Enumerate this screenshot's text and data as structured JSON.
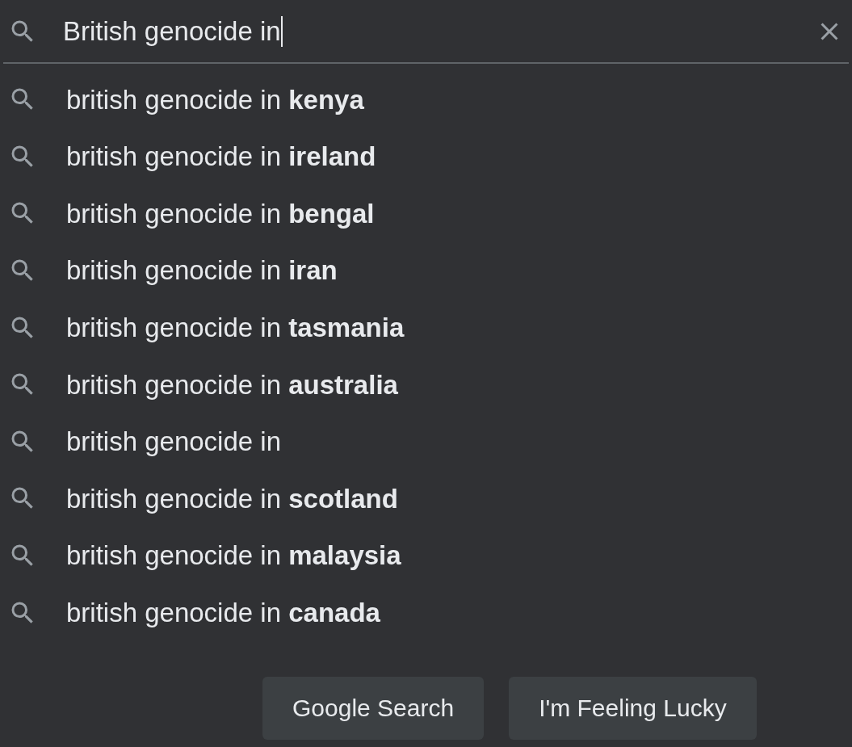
{
  "search": {
    "value": "British genocide in"
  },
  "suggestions": [
    {
      "text": "british genocide in **kenya**"
    },
    {
      "text": "british genocide in **ireland**"
    },
    {
      "text": "british genocide in **bengal**"
    },
    {
      "text": "british genocide in **iran**"
    },
    {
      "text": "british genocide in **tasmania**"
    },
    {
      "text": "british genocide in **australia**"
    },
    {
      "text": "british genocide in"
    },
    {
      "text": "british genocide in **scotland**"
    },
    {
      "text": "british genocide in **malaysia**"
    },
    {
      "text": "british genocide in **canada**"
    }
  ],
  "buttons": [
    "Google Search",
    "I'm Feeling Lucky"
  ]
}
